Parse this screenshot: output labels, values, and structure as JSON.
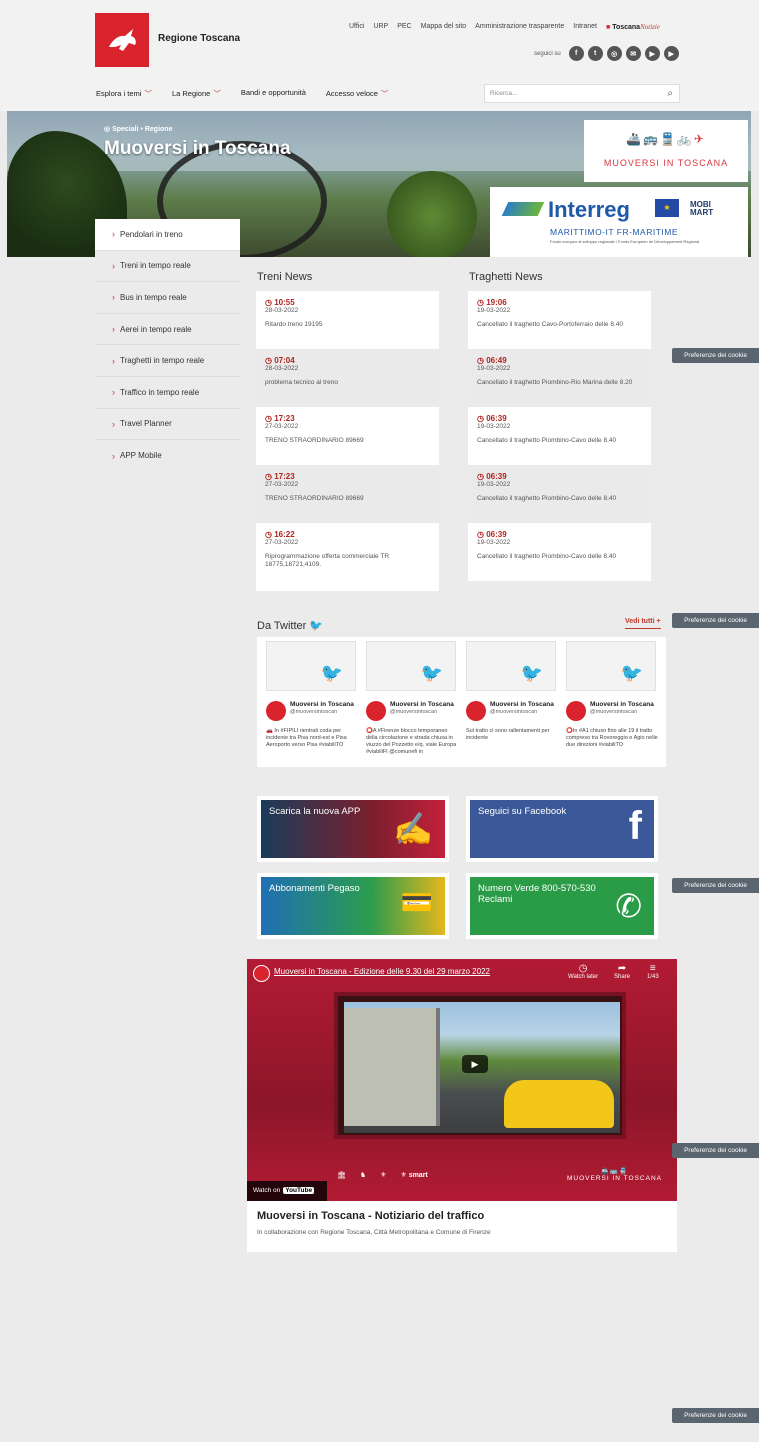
{
  "header": {
    "site_name": "Regione Toscana",
    "toplinks": [
      "Uffici",
      "URP",
      "PEC",
      "Mappa del sito",
      "Amministrazione trasparente",
      "Intranet"
    ],
    "toscana_notizie": {
      "a": "Toscana",
      "b": "Notizie"
    },
    "follow_label": "seguici su",
    "social": [
      "f",
      "t",
      "◎",
      "✉",
      "▶",
      "▶"
    ]
  },
  "nav": {
    "items": [
      {
        "label": "Esplora i temi",
        "has_menu": true
      },
      {
        "label": "La Regione",
        "has_menu": true
      },
      {
        "label": "Bandi e opportunità",
        "has_menu": false
      },
      {
        "label": "Accesso veloce",
        "has_menu": true
      }
    ],
    "search_placeholder": "Ricerca..."
  },
  "hero": {
    "kicker": "Speciali • Regione",
    "title": "Muoversi in Toscana",
    "logo_text": "MUOVERSI IN TOSCANA",
    "interreg_name": "Interreg",
    "interreg_program": "MARITTIMO-IT FR-MARITIME",
    "interreg_fund": "Fondo europeo di sviluppo regionale / Fonds Européen de Développement Régional",
    "mobi": "MOBI",
    "mart": "MART"
  },
  "sidebar": {
    "items": [
      "Pendolari in treno",
      "Treni in tempo reale",
      "Bus in tempo reale",
      "Aerei in tempo reale",
      "Traghetti in tempo reale",
      "Traffico in tempo reale",
      "Travel Planner",
      "APP Mobile"
    ]
  },
  "treni": {
    "title": "Treni News",
    "items": [
      {
        "time": "10:55",
        "date": "28-03-2022",
        "msg": "Ritardo treno 19195"
      },
      {
        "time": "07:04",
        "date": "28-03-2022",
        "msg": "problema tecnico al treno"
      },
      {
        "time": "17:23",
        "date": "27-03-2022",
        "msg": "TRENO STRAORDINARIO 89669"
      },
      {
        "time": "17:23",
        "date": "27-03-2022",
        "msg": "TRENO STRAORDINARIO 89669"
      },
      {
        "time": "16:22",
        "date": "27-03-2022",
        "msg": "Riprogrammazione offerta commerciale TR 18775,18721,4109."
      }
    ]
  },
  "traghetti": {
    "title": "Traghetti News",
    "items": [
      {
        "time": "19:06",
        "date": "19-03-2022",
        "msg": "Cancellato il traghetto Cavo-Portoferraio delle 8.40"
      },
      {
        "time": "06:49",
        "date": "19-03-2022",
        "msg": "Cancellato il traghetto Piombino-Rio Marina delle 8.20"
      },
      {
        "time": "06:39",
        "date": "19-03-2022",
        "msg": "Cancellato il traghetto Piombino-Cavo delle 8.40"
      },
      {
        "time": "06:39",
        "date": "19-03-2022",
        "msg": "Cancellato il traghetto Piombino-Cavo delle 8.40"
      },
      {
        "time": "06:39",
        "date": "19-03-2022",
        "msg": "Cancellato il traghetto Piombino-Cavo delle 8.40"
      }
    ]
  },
  "twitter": {
    "title": "Da Twitter",
    "see_all": "Vedi tutti",
    "tweets": [
      {
        "name": "Muoversi in Toscana",
        "handle": "@muoversintoscan",
        "text": "🚗 In #FIPILI rientrati coda per incidente tra Pisa nord-est e Pisa Aeroporto verso Pisa #viabiliTO"
      },
      {
        "name": "Muoversi in Toscana",
        "handle": "@muoversintoscan",
        "text": "⭕A #Firenze blocco temporaneo della circolazione e strada chiusa in viuzzo del Pozzetto e/q. viale Europa #viabiliFI @comunefi in"
      },
      {
        "name": "Muoversi in Toscana",
        "handle": "@muoversintoscan",
        "text": "Sul tratto ci sono rallentamenti per incidente"
      },
      {
        "name": "Muoversi in Toscana",
        "handle": "@muoversintoscan",
        "text": "⭕In #A1 chiuso fino alle 19 il tratto compreso tra Rovoreggio e Agio nelle due direzioni #viabiliTO"
      }
    ]
  },
  "tiles": {
    "app": "Scarica la nuova APP",
    "facebook": "Seguici su Facebook",
    "pegaso": "Abbonamenti Pegaso",
    "numero": "Numero Verde 800-570-530 Reclami"
  },
  "video": {
    "title": "Muoversi in Toscana - Edizione delle 9.30 del 29 marzo 2022",
    "watch_later": "Watch later",
    "share": "Share",
    "count": "1/43",
    "watch_on": "Watch on",
    "youtube": "YouTube",
    "caption_title": "Muoversi in Toscana - Notiziario del traffico",
    "caption_sub": "In collaborazione con Regione Toscana, Città Metropolitana e Comune di Firenze",
    "logo_text": "MUOVERSI IN TOSCANA",
    "firenze_smart": "smart"
  },
  "cookie_label": "Preferenze dei cookie"
}
